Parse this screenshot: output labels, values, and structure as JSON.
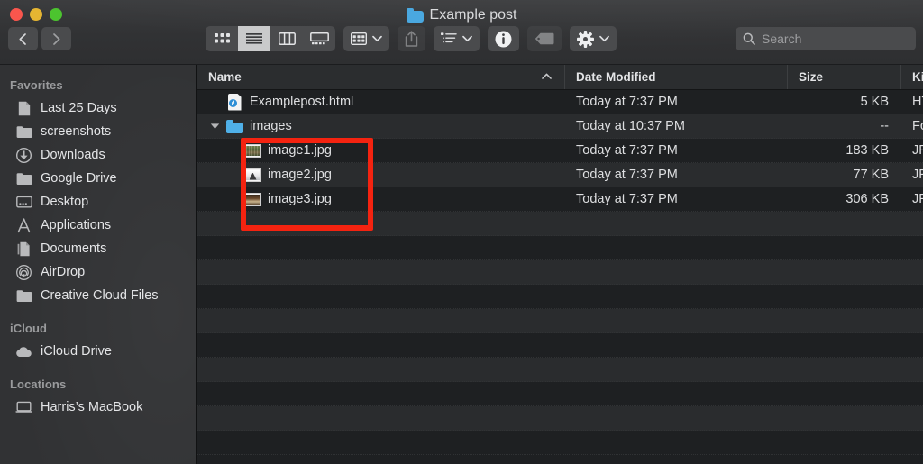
{
  "window": {
    "title": "Example post",
    "title_icon": "blue-folder-icon",
    "traffic_lights": [
      {
        "name": "close",
        "color": "#f9564d"
      },
      {
        "name": "minimize",
        "color": "#e5b532"
      },
      {
        "name": "zoom",
        "color": "#4cc42f"
      }
    ]
  },
  "toolbar": {
    "back_label": "Back",
    "forward_label": "Forward",
    "view_modes": [
      {
        "name": "icon-view",
        "label": "Icon View",
        "active": false
      },
      {
        "name": "list-view",
        "label": "List View",
        "active": true
      },
      {
        "name": "column-view",
        "label": "Column View",
        "active": false
      },
      {
        "name": "gallery-view",
        "label": "Gallery View",
        "active": false
      }
    ],
    "group_by_label": "Group Items",
    "share_label": "Share",
    "arrange_label": "Arrange By",
    "info_label": "Get Info",
    "tag_label": "Edit Tags",
    "action_label": "Action",
    "search": {
      "placeholder": "Search",
      "value": ""
    }
  },
  "sidebar": {
    "sections": [
      {
        "heading": "Favorites",
        "items": [
          {
            "label": "Last 25 Days",
            "icon": "document-icon"
          },
          {
            "label": "screenshots",
            "icon": "folder-icon"
          },
          {
            "label": "Downloads",
            "icon": "downloads-icon"
          },
          {
            "label": "Google Drive",
            "icon": "folder-icon"
          },
          {
            "label": "Desktop",
            "icon": "desktop-icon"
          },
          {
            "label": "Applications",
            "icon": "applications-icon"
          },
          {
            "label": "Documents",
            "icon": "documents-icon"
          },
          {
            "label": "AirDrop",
            "icon": "airdrop-icon"
          },
          {
            "label": "Creative Cloud Files",
            "icon": "folder-icon"
          }
        ]
      },
      {
        "heading": "iCloud",
        "items": [
          {
            "label": "iCloud Drive",
            "icon": "cloud-icon"
          }
        ]
      },
      {
        "heading": "Locations",
        "items": [
          {
            "label": "Harris’s MacBook",
            "icon": "laptop-icon"
          }
        ]
      }
    ]
  },
  "file_list": {
    "columns": [
      {
        "key": "name",
        "label": "Name",
        "sorted": true,
        "sort_direction": "ascending"
      },
      {
        "key": "date",
        "label": "Date Modified"
      },
      {
        "key": "size",
        "label": "Size"
      },
      {
        "key": "kind",
        "label": "Ki"
      }
    ],
    "rows": [
      {
        "name": "Examplepost.html",
        "date": "Today at 7:37 PM",
        "size": "5 KB",
        "kind": "HT",
        "icon": "html-document-icon",
        "depth": 0,
        "expandable": false
      },
      {
        "name": "images",
        "date": "Today at 10:37 PM",
        "size": "--",
        "kind": "Fo",
        "icon": "blue-folder-icon",
        "depth": 0,
        "expandable": true,
        "expanded": true
      },
      {
        "name": "image1.jpg",
        "date": "Today at 7:37 PM",
        "size": "183 KB",
        "kind": "JP",
        "icon": "photo-thumbnail-1",
        "depth": 1,
        "expandable": false
      },
      {
        "name": "image2.jpg",
        "date": "Today at 7:37 PM",
        "size": "77 KB",
        "kind": "JP",
        "icon": "photo-thumbnail-2",
        "depth": 1,
        "expandable": false
      },
      {
        "name": "image3.jpg",
        "date": "Today at 7:37 PM",
        "size": "306 KB",
        "kind": "JP",
        "icon": "photo-thumbnail-3",
        "depth": 1,
        "expandable": false
      }
    ],
    "empty_row_count": 10
  },
  "annotation": {
    "type": "rectangle-highlight",
    "color": "#f42310",
    "targets": [
      "image1.jpg",
      "image2.jpg",
      "image3.jpg"
    ]
  }
}
